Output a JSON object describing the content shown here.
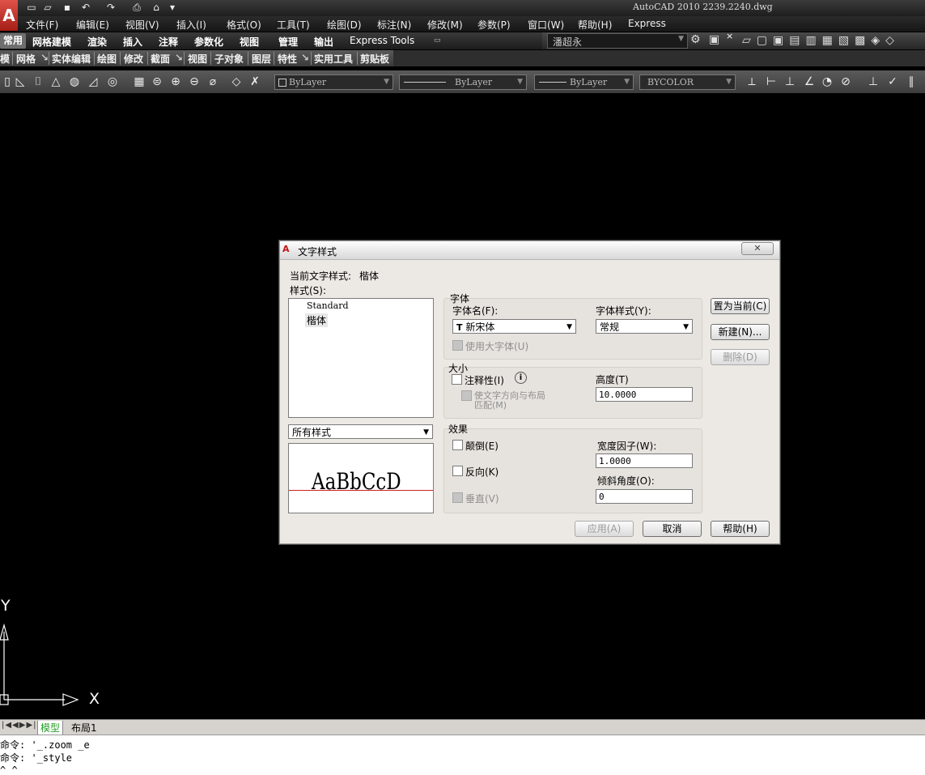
{
  "window": {
    "title": "AutoCAD 2010    2239.2240.dwg",
    "app_logo": "A"
  },
  "quick_access": [
    "new-icon",
    "open-icon",
    "save-icon",
    "undo-icon",
    "redo-icon",
    "plot-icon",
    "properties-icon"
  ],
  "menu": [
    "文件(F)",
    "编辑(E)",
    "视图(V)",
    "插入(I)",
    "格式(O)",
    "工具(T)",
    "绘图(D)",
    "标注(N)",
    "修改(M)",
    "参数(P)",
    "窗口(W)",
    "帮助(H)",
    "Express"
  ],
  "ribbon_tabs": [
    "常用",
    "网格建模",
    "渲染",
    "插入",
    "注释",
    "参数化",
    "视图",
    "管理",
    "输出",
    "Express Tools"
  ],
  "workspace_user": "潘超永",
  "panel_tabs": [
    "模",
    "网格",
    "实体编辑",
    "绘图",
    "修改",
    "截面",
    "视图",
    "子对象",
    "图层",
    "特性",
    "实用工具",
    "剪贴板"
  ],
  "toolbar": {
    "color": "ByLayer",
    "linetype": "ByLayer",
    "lineweight": "ByLayer",
    "plotstyle": "BYCOLOR"
  },
  "dialog": {
    "title": "文字样式",
    "current_style_label": "当前文字样式:",
    "current_style_value": "楷体",
    "styles_label": "样式(S):",
    "styles": [
      "Standard",
      "楷体"
    ],
    "filter_value": "所有样式",
    "preview_text": "AaBbCcD",
    "font_group": "字体",
    "font_name_label": "字体名(F):",
    "font_name_value": "新宋体",
    "font_style_label": "字体样式(Y):",
    "font_style_value": "常规",
    "big_font_label": "使用大字体(U)",
    "size_group": "大小",
    "annotative_label": "注释性(I)",
    "match_orientation_label_1": "使文字方向与布局",
    "match_orientation_label_2": "匹配(M)",
    "height_label": "高度(T)",
    "height_value": "10.0000",
    "effects_group": "效果",
    "upside_down_label": "颠倒(E)",
    "backwards_label": "反向(K)",
    "vertical_label": "垂直(V)",
    "width_factor_label": "宽度因子(W):",
    "width_factor_value": "1.0000",
    "oblique_label": "倾斜角度(O):",
    "oblique_value": "0",
    "btn_set_current": "置为当前(C)",
    "btn_new": "新建(N)...",
    "btn_delete": "删除(D)",
    "btn_apply": "应用(A)",
    "btn_cancel": "取消",
    "btn_help": "帮助(H)"
  },
  "ucs": {
    "x_label": "X",
    "y_label": "Y"
  },
  "layout_tabs": [
    "模型",
    "布局1"
  ],
  "command_history": [
    "命令: '_.zoom _e",
    "命令: '_style"
  ],
  "command_prompt": "^ ^"
}
